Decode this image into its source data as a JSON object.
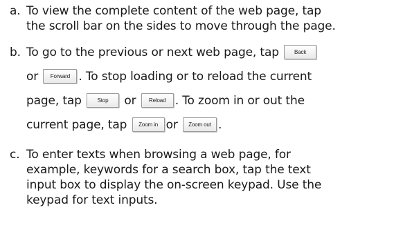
{
  "items": [
    {
      "marker": "a.",
      "lines": [
        "To view the complete content of the web page, tap",
        "the scroll bar on the sides to move through the page."
      ]
    },
    {
      "marker": "b.",
      "segments": [
        "To go to the previous or next web page, tap",
        "or",
        ". To stop loading or to reload the current",
        "page, tap",
        "or",
        ". To zoom in or out the",
        "current page, tap",
        "or",
        "."
      ],
      "buttons": {
        "back": "Back",
        "forward": "Forward",
        "stop": "Stop",
        "reload": "Reload",
        "zoom_in": "Zoom in",
        "zoom_out": "Zoom out"
      }
    },
    {
      "marker": "c.",
      "lines": [
        "To enter texts when browsing a web page, for",
        "example, keywords for a search box, tap the text",
        "input box to display the on-screen keypad. Use the",
        "keypad for text inputs."
      ]
    }
  ]
}
